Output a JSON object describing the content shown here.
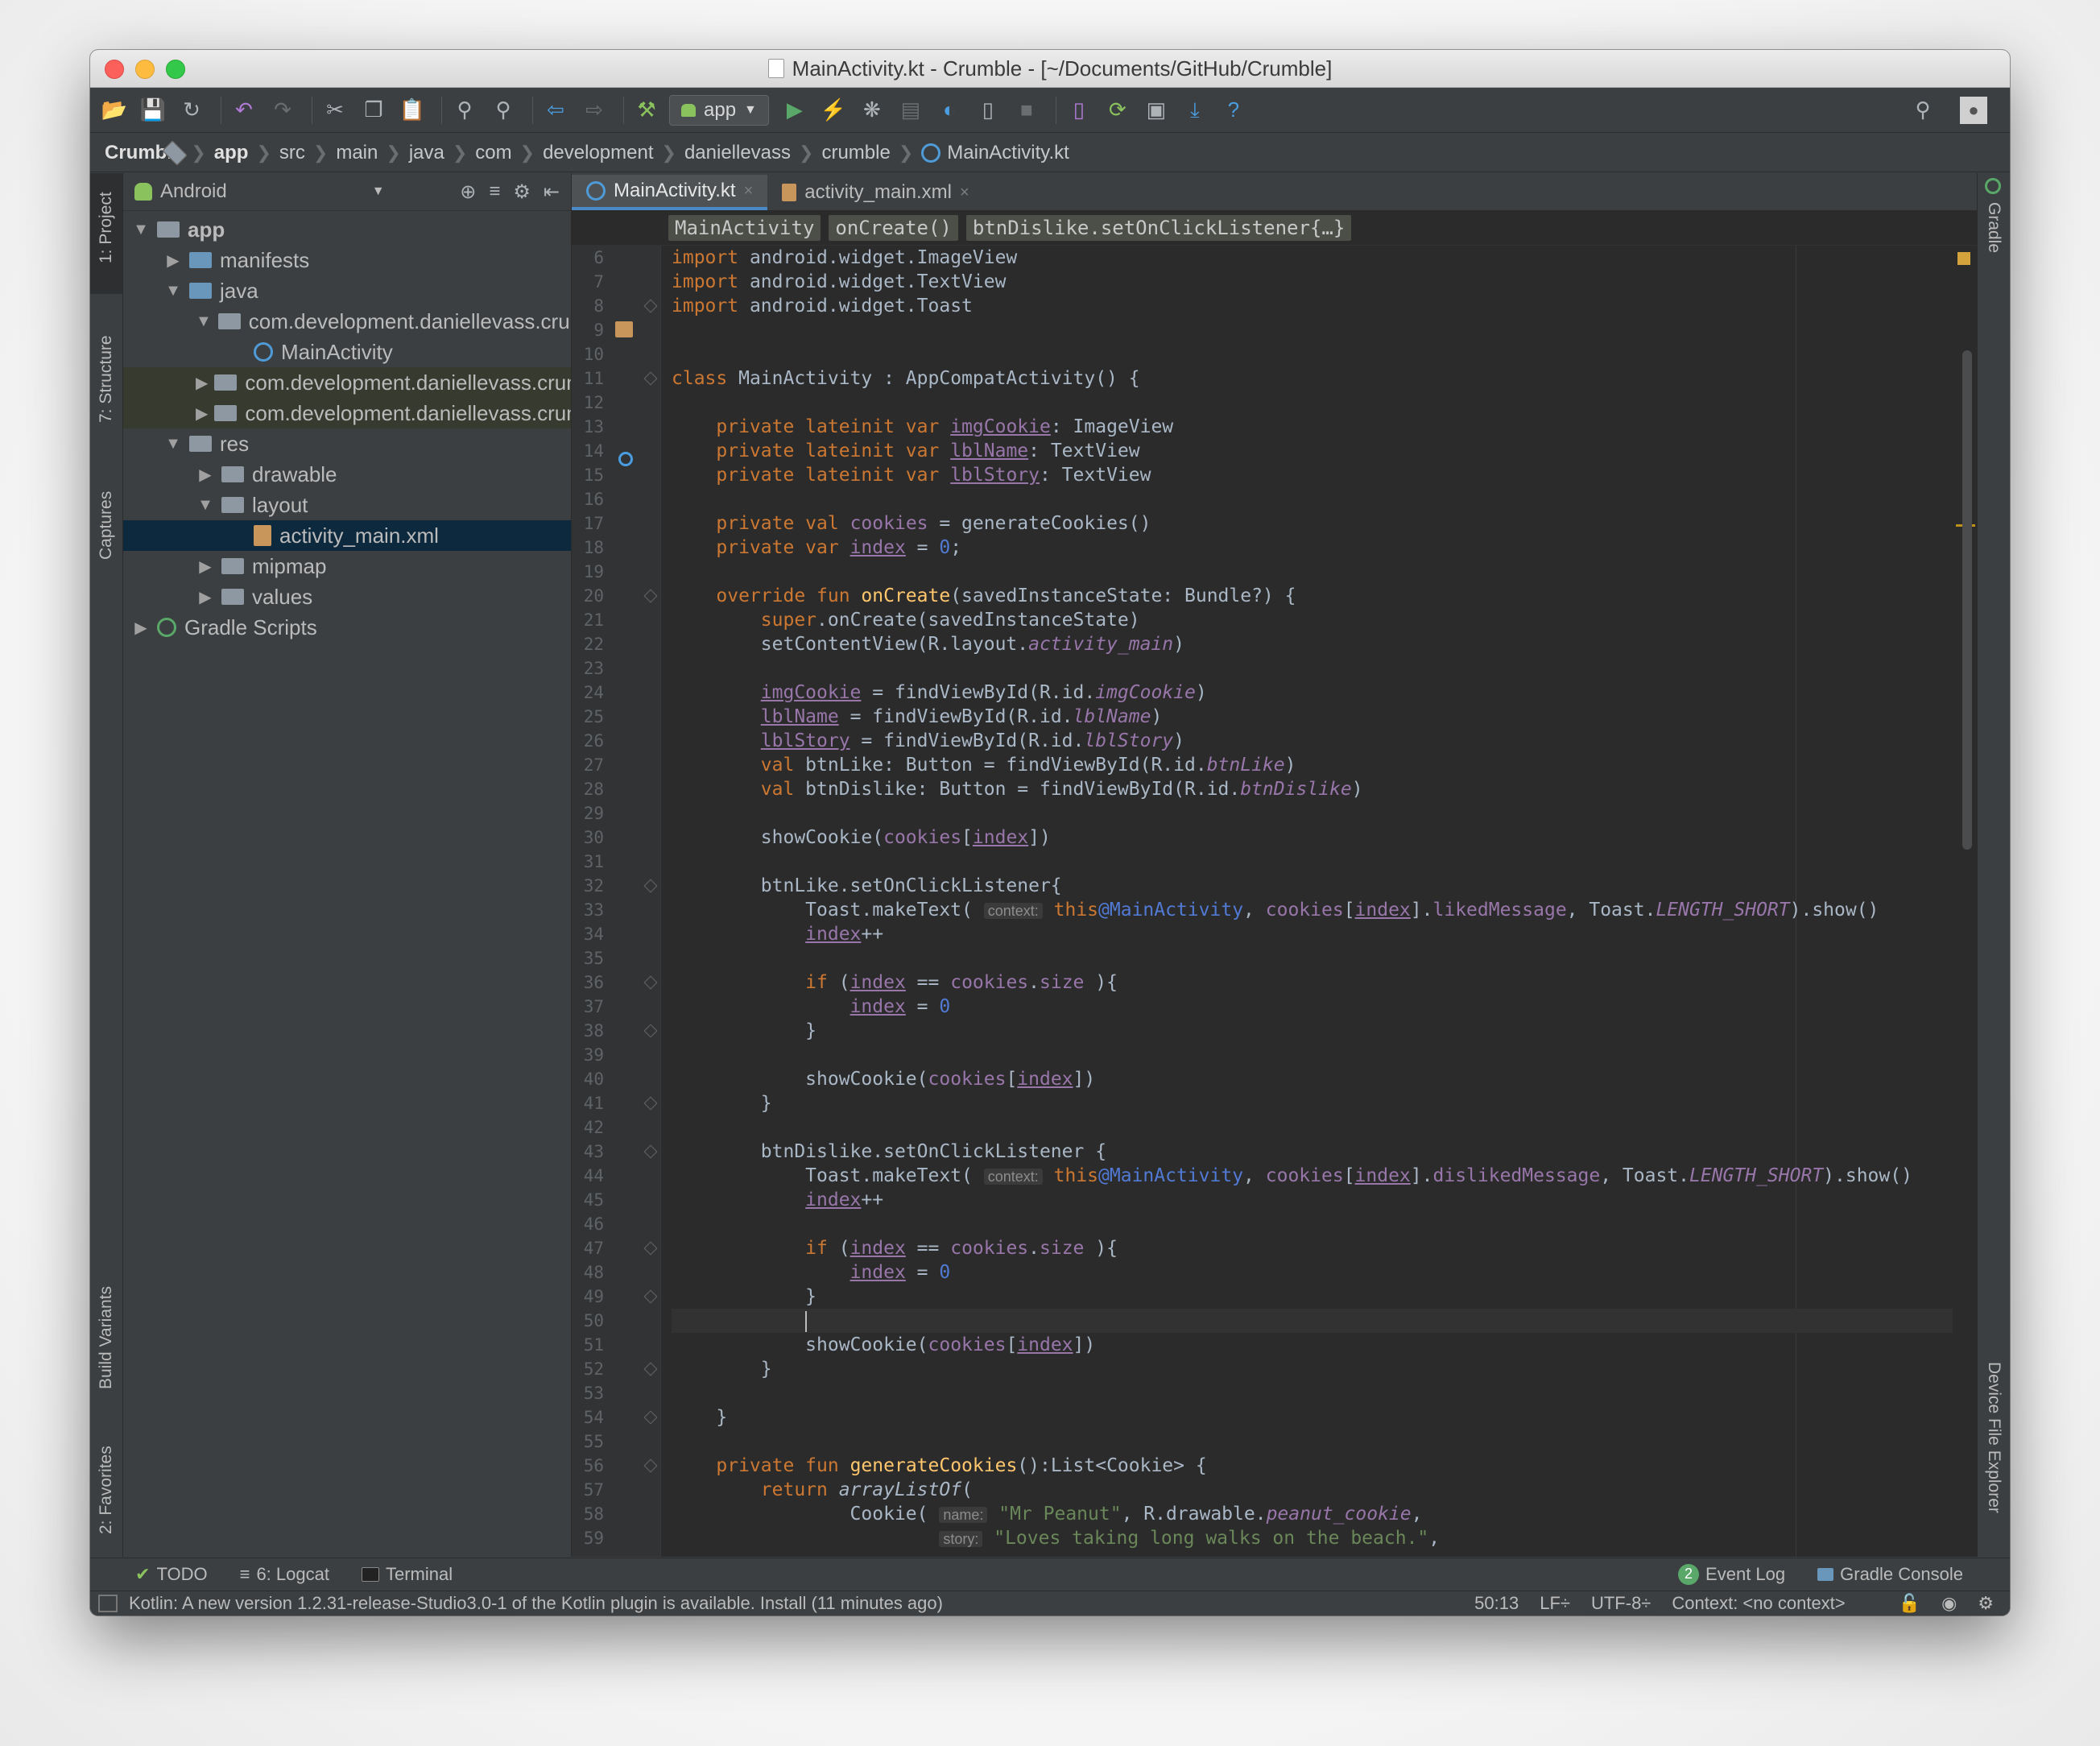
{
  "window": {
    "title": "MainActivity.kt - Crumble - [~/Documents/GitHub/Crumble]"
  },
  "toolbar": {
    "run_config": "app",
    "icons": [
      "open-folder-icon",
      "save-icon",
      "sync-icon",
      "undo-icon",
      "redo-icon",
      "cut-icon",
      "copy-icon",
      "paste-icon",
      "find-icon",
      "replace-icon",
      "back-icon",
      "forward-icon",
      "build-hammer-icon",
      "run-icon",
      "apply-changes-icon",
      "debug-icon",
      "profile-icon",
      "attach-debugger-icon",
      "stop-icon",
      "avd-manager-icon",
      "sdk-manager-icon",
      "gradle-sync-icon",
      "layout-inspector-icon",
      "download-icon",
      "help-icon",
      "search-icon",
      "user-icon"
    ],
    "help_glyph": "?"
  },
  "breadcrumb": [
    "Crumble",
    "app",
    "src",
    "main",
    "java",
    "com",
    "development",
    "daniellevass",
    "crumble",
    "MainActivity.kt"
  ],
  "left_tools": [
    "1: Project",
    "7: Structure",
    "Captures",
    "Build Variants",
    "2: Favorites"
  ],
  "right_tools": [
    "Gradle",
    "Device File Explorer"
  ],
  "project": {
    "view": "Android",
    "tree": [
      {
        "label": "app",
        "depth": 0,
        "arrow": "▼",
        "icon": "gray",
        "bold": true
      },
      {
        "label": "manifests",
        "depth": 1,
        "arrow": "▶",
        "icon": "blue"
      },
      {
        "label": "java",
        "depth": 1,
        "arrow": "▼",
        "icon": "blue"
      },
      {
        "label": "com.development.daniellevass.crumble",
        "depth": 2,
        "arrow": "▼",
        "icon": "gray"
      },
      {
        "label": "MainActivity",
        "depth": 3,
        "arrow": "",
        "icon": "kt"
      },
      {
        "label": "com.development.daniellevass.crumble",
        "depth": 2,
        "arrow": "▶",
        "icon": "gray",
        "hl": true
      },
      {
        "label": "com.development.daniellevass.crumble",
        "depth": 2,
        "arrow": "▶",
        "icon": "gray",
        "hl": true
      },
      {
        "label": "res",
        "depth": 1,
        "arrow": "▼",
        "icon": "gray"
      },
      {
        "label": "drawable",
        "depth": 2,
        "arrow": "▶",
        "icon": "gray"
      },
      {
        "label": "layout",
        "depth": 2,
        "arrow": "▼",
        "icon": "gray"
      },
      {
        "label": "activity_main.xml",
        "depth": 3,
        "arrow": "",
        "icon": "xml",
        "sel": true
      },
      {
        "label": "mipmap",
        "depth": 2,
        "arrow": "▶",
        "icon": "gray"
      },
      {
        "label": "values",
        "depth": 2,
        "arrow": "▶",
        "icon": "gray"
      },
      {
        "label": "Gradle Scripts",
        "depth": 0,
        "arrow": "▶",
        "icon": "gradle"
      }
    ]
  },
  "editor": {
    "tabs": [
      {
        "label": "MainActivity.kt",
        "close": "×",
        "active": true
      },
      {
        "label": "activity_main.xml",
        "close": "×",
        "active": false
      }
    ],
    "code_breadcrumbs": [
      "MainActivity",
      "onCreate()",
      "btnDislike.setOnClickListener{…}"
    ],
    "lines": [
      {
        "n": "6",
        "html": "<span class='k'>import</span> android.widget.ImageView"
      },
      {
        "n": "7",
        "html": "<span class='k'>import</span> android.widget.TextView"
      },
      {
        "n": "8",
        "html": "<span class='k'>import</span> android.widget.Toast"
      },
      {
        "n": "9",
        "html": ""
      },
      {
        "n": "10",
        "html": ""
      },
      {
        "n": "11",
        "html": "<span class='k'>class</span> MainActivity : AppCompatActivity() {"
      },
      {
        "n": "12",
        "html": ""
      },
      {
        "n": "13",
        "html": "    <span class='k'>private lateinit var</span> <span class='p u'>imgCookie</span>: ImageView"
      },
      {
        "n": "14",
        "html": "    <span class='k'>private lateinit var</span> <span class='p u'>lblName</span>: TextView"
      },
      {
        "n": "15",
        "html": "    <span class='k'>private lateinit var</span> <span class='p u'>lblStory</span>: TextView"
      },
      {
        "n": "16",
        "html": ""
      },
      {
        "n": "17",
        "html": "    <span class='k'>private val</span> <span class='p'>cookies</span> = generateCookies()"
      },
      {
        "n": "18",
        "html": "    <span class='k'>private var</span> <span class='p u'>index</span> = <span class='lbl'>0</span>;"
      },
      {
        "n": "19",
        "html": ""
      },
      {
        "n": "20",
        "html": "    <span class='k'>override fun</span> <span class='f'>onCreate</span>(savedInstanceState: Bundle?) {"
      },
      {
        "n": "21",
        "html": "        <span class='k'>super</span>.onCreate(savedInstanceState)"
      },
      {
        "n": "22",
        "html": "        setContentView(R.layout.<span class='pi'>activity_main</span>)"
      },
      {
        "n": "23",
        "html": ""
      },
      {
        "n": "24",
        "html": "        <span class='p u'>imgCookie</span> = findViewById(R.id.<span class='pi'>imgCookie</span>)"
      },
      {
        "n": "25",
        "html": "        <span class='p u'>lblName</span> = findViewById(R.id.<span class='pi'>lblName</span>)"
      },
      {
        "n": "26",
        "html": "        <span class='p u'>lblStory</span> = findViewById(R.id.<span class='pi'>lblStory</span>)"
      },
      {
        "n": "27",
        "html": "        <span class='k'>val</span> btnLike: Button = findViewById(R.id.<span class='pi'>btnLike</span>)"
      },
      {
        "n": "28",
        "html": "        <span class='k'>val</span> btnDislike: Button = findViewById(R.id.<span class='pi'>btnDislike</span>)"
      },
      {
        "n": "29",
        "html": ""
      },
      {
        "n": "30",
        "html": "        showCookie(<span class='p'>cookies</span>[<span class='p u'>index</span>])"
      },
      {
        "n": "31",
        "html": ""
      },
      {
        "n": "32",
        "html": "        btnLike.setOnClickListener{"
      },
      {
        "n": "33",
        "html": "            Toast.makeText( <span class='hint'>context:</span> <span class='k'>this</span><span class='lbl'>@MainActivity</span>, <span class='p'>cookies</span>[<span class='p u'>index</span>].<span class='p'>likedMessage</span>, Toast.<span class='pi'>LENGTH_SHORT</span>).show()"
      },
      {
        "n": "34",
        "html": "            <span class='p u'>index</span>++"
      },
      {
        "n": "35",
        "html": ""
      },
      {
        "n": "36",
        "html": "            <span class='k'>if</span> (<span class='p u'>index</span> == <span class='p'>cookies</span>.<span class='p'>size</span> ){"
      },
      {
        "n": "37",
        "html": "                <span class='p u'>index</span> = <span class='lbl'>0</span>"
      },
      {
        "n": "38",
        "html": "            }"
      },
      {
        "n": "39",
        "html": ""
      },
      {
        "n": "40",
        "html": "            showCookie(<span class='p'>cookies</span>[<span class='p u'>index</span>])"
      },
      {
        "n": "41",
        "html": "        }"
      },
      {
        "n": "42",
        "html": ""
      },
      {
        "n": "43",
        "html": "        btnDislike.setOnClickListener {"
      },
      {
        "n": "44",
        "html": "            Toast.makeText( <span class='hint'>context:</span> <span class='k'>this</span><span class='lbl'>@MainActivity</span>, <span class='p'>cookies</span>[<span class='p u'>index</span>].<span class='p'>dislikedMessage</span>, Toast.<span class='pi'>LENGTH_SHORT</span>).show()"
      },
      {
        "n": "45",
        "html": "            <span class='p u'>index</span>++"
      },
      {
        "n": "46",
        "html": ""
      },
      {
        "n": "47",
        "html": "            <span class='k'>if</span> (<span class='p u'>index</span> == <span class='p'>cookies</span>.<span class='p'>size</span> ){"
      },
      {
        "n": "48",
        "html": "                <span class='p u'>index</span> = <span class='lbl'>0</span>"
      },
      {
        "n": "49",
        "html": "            }"
      },
      {
        "n": "50",
        "html": "            <span class='caret'></span>",
        "cur": true
      },
      {
        "n": "51",
        "html": "            showCookie(<span class='p'>cookies</span>[<span class='p u'>index</span>])"
      },
      {
        "n": "52",
        "html": "        }"
      },
      {
        "n": "53",
        "html": ""
      },
      {
        "n": "54",
        "html": "    }"
      },
      {
        "n": "55",
        "html": ""
      },
      {
        "n": "56",
        "html": "    <span class='k'>private fun</span> <span class='f'>generateCookies</span>():List&lt;Cookie&gt; {"
      },
      {
        "n": "57",
        "html": "        <span class='k'>return</span> <span class='pi' style='color:#a9b7c6'>arrayListOf</span>("
      },
      {
        "n": "58",
        "html": "                Cookie( <span class='hint'>name:</span> <span class='s'>\"Mr Peanut\"</span>, R.drawable.<span class='pi'>peanut_cookie</span>,"
      },
      {
        "n": "59",
        "html": "                        <span class='hint'>story:</span> <span class='s'>\"Loves taking long walks on the beach.\"</span>,"
      }
    ]
  },
  "bottom_tools": {
    "left": [
      {
        "label": "TODO",
        "icon": "todo-icon"
      },
      {
        "label": "6: Logcat",
        "icon": "logcat-icon"
      },
      {
        "label": "Terminal",
        "icon": "terminal-icon"
      }
    ],
    "event_log_count": "2",
    "event_log": "Event Log",
    "gradle_console": "Gradle Console"
  },
  "status": {
    "message": "Kotlin: A new version 1.2.31-release-Studio3.0-1 of the Kotlin plugin is available. Install (11 minutes ago)",
    "position": "50:13",
    "line_sep": "LF÷",
    "encoding": "UTF-8÷",
    "context": "Context: <no context>"
  },
  "colors": {
    "keyword": "#cc7832",
    "function": "#ffc66d",
    "property": "#9876aa",
    "string": "#6a8759",
    "editor_bg": "#2b2b2b",
    "selection": "#0d293e"
  }
}
